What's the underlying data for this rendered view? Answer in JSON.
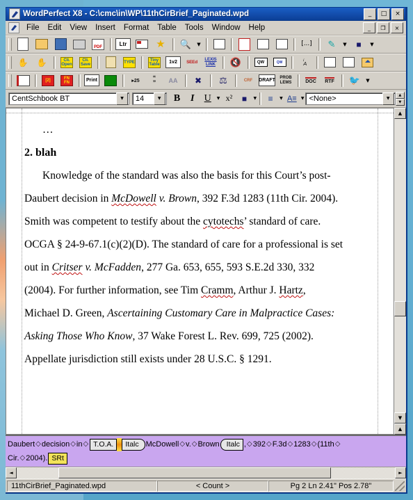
{
  "window": {
    "title": "WordPerfect X8 - C:\\cmc\\in\\WP\\11thCirBrief_Paginated.wpd",
    "app_icon": "wordperfect-pen-icon",
    "controls": {
      "minimize": "_",
      "maximize": "□",
      "close": "×"
    },
    "mdi_controls": {
      "minimize": "_",
      "restore": "❐",
      "close": "×"
    }
  },
  "menubar": {
    "doc_icon": "document-icon",
    "items": [
      {
        "label": "File",
        "mnemonic": "F"
      },
      {
        "label": "Edit",
        "mnemonic": "E"
      },
      {
        "label": "View",
        "mnemonic": "V"
      },
      {
        "label": "Insert",
        "mnemonic": "I"
      },
      {
        "label": "Format",
        "mnemonic": "o"
      },
      {
        "label": "Table",
        "mnemonic": "a"
      },
      {
        "label": "Tools",
        "mnemonic": "T"
      },
      {
        "label": "Window",
        "mnemonic": "W"
      },
      {
        "label": "Help",
        "mnemonic": "H"
      }
    ]
  },
  "toolbar_main": {
    "buttons": [
      {
        "name": "new-document-button",
        "icon": "blank-page-icon",
        "label": ""
      },
      {
        "name": "open-document-button",
        "icon": "open-folder-icon",
        "label": ""
      },
      {
        "name": "save-document-button",
        "icon": "floppy-disk-icon",
        "label": ""
      },
      {
        "name": "print-button",
        "icon": "printer-icon",
        "label": ""
      },
      {
        "name": "publish-pdf-button",
        "icon": "pdf-icon",
        "label": "PDF"
      },
      {
        "name": "letter-macro-button",
        "icon": "ltr-label-icon",
        "label": "Ltr"
      },
      {
        "name": "envelope-button",
        "icon": "envelope-icon",
        "label": "ENV"
      },
      {
        "name": "favorite-button",
        "icon": "star-icon",
        "label": ""
      },
      {
        "name": "zoom-button",
        "icon": "magnifier-icon",
        "label": ""
      },
      {
        "name": "zoom-dropdown",
        "icon": "chevron-down-icon",
        "label": ""
      },
      {
        "name": "show-hide-button",
        "icon": "show-codes-icon",
        "label": ""
      },
      {
        "name": "redline-button",
        "icon": "red-page-icon",
        "label": ""
      },
      {
        "name": "two-page-button",
        "icon": "two-page-icon",
        "label": ""
      },
      {
        "name": "page-setup-button",
        "icon": "page-setup-icon",
        "label": ""
      },
      {
        "name": "insert-field-button",
        "icon": "brackets-icon",
        "label": "[...]"
      },
      {
        "name": "highlight-button",
        "icon": "highlighter-pen-icon",
        "label": ""
      },
      {
        "name": "highlight-dropdown",
        "icon": "chevron-down-icon",
        "label": ""
      },
      {
        "name": "fill-color-button",
        "icon": "paint-bucket-icon",
        "label": ""
      },
      {
        "name": "fill-color-dropdown",
        "icon": "chevron-down-icon",
        "label": ""
      }
    ]
  },
  "toolbar_second": {
    "buttons": [
      {
        "name": "macro-play-button",
        "icon": "macro-icon",
        "label": ""
      },
      {
        "name": "macro-record-button",
        "icon": "macro-record-icon",
        "label": ""
      },
      {
        "name": "client-open-button",
        "icon": "client-open-icon",
        "label": "Cli. Open"
      },
      {
        "name": "client-save-button",
        "icon": "client-save-icon",
        "label": "Cli. Save"
      },
      {
        "name": "clipboard-button",
        "icon": "clipboard-icon",
        "label": ""
      },
      {
        "name": "type-button",
        "icon": "type-icon",
        "label": "TYPE"
      },
      {
        "name": "tiny-table-button",
        "icon": "tiny-table-icon",
        "label": "Tiny Table"
      },
      {
        "name": "line-numbering-button",
        "icon": "line-numbering-icon",
        "label": "1v2"
      },
      {
        "name": "seed-button",
        "icon": "seed-icon",
        "label": "SEEd"
      },
      {
        "name": "lexis-link-button",
        "icon": "lexis-link-icon",
        "label": "LEXIS LINK"
      },
      {
        "name": "mute-button",
        "icon": "no-bell-icon",
        "label": ""
      },
      {
        "name": "quickwords-button",
        "icon": "quickwords-icon",
        "label": "QW"
      },
      {
        "name": "quickwords-edit-button",
        "icon": "quickwords-edit-icon",
        "label": "QW"
      },
      {
        "name": "subscript-button",
        "icon": "subscript-icon",
        "label": "A"
      },
      {
        "name": "indent-button",
        "icon": "indent-icon",
        "label": ""
      },
      {
        "name": "double-indent-button",
        "icon": "double-indent-icon",
        "label": ""
      },
      {
        "name": "open-folder-arrow-button",
        "icon": "folder-up-icon",
        "label": ""
      }
    ]
  },
  "toolbar_third": {
    "buttons": [
      {
        "name": "reading-view-button",
        "icon": "book-icon",
        "label": ""
      },
      {
        "name": "numbering-button",
        "icon": "bracket-number-icon",
        "label": "[2]"
      },
      {
        "name": "footnote-button",
        "icon": "footnote-icon",
        "label": "FN FN"
      },
      {
        "name": "print-excel-button",
        "icon": "excel-print-icon",
        "label": "Print"
      },
      {
        "name": "green-table-button",
        "icon": "green-sheet-icon",
        "label": ""
      },
      {
        "name": "indent-25-button",
        "icon": "indent-25-icon",
        "label": "25"
      },
      {
        "name": "quotation-button",
        "icon": "quote-marks-icon",
        "label": ""
      },
      {
        "name": "small-caps-button",
        "icon": "small-caps-icon",
        "label": "AA"
      },
      {
        "name": "delete-link-button",
        "icon": "broken-link-icon",
        "label": ""
      },
      {
        "name": "scales-button",
        "icon": "scales-of-justice-icon",
        "label": ""
      },
      {
        "name": "crf-button",
        "icon": "crf-arrow-icon",
        "label": "CRF"
      },
      {
        "name": "draft-button",
        "icon": "draft-icon",
        "label": "DRAFT"
      },
      {
        "name": "problems-button",
        "icon": "problems-icon",
        "label": "PROB LEMS"
      },
      {
        "name": "save-as-doc-button",
        "icon": "doc-export-icon",
        "label": "DOC"
      },
      {
        "name": "save-as-rtf-button",
        "icon": "rtf-export-icon",
        "label": "RTF"
      },
      {
        "name": "bird-macro-button",
        "icon": "bird-icon",
        "label": ""
      },
      {
        "name": "bird-macro-dropdown",
        "icon": "chevron-down-icon",
        "label": ""
      }
    ]
  },
  "propertybar": {
    "font_name": "CentSchbook BT",
    "font_size": "14",
    "bold_label": "B",
    "italic_label": "I",
    "underline_label": "U",
    "superscript_label": "x²",
    "highlight_icon": "paint-bucket-a-icon",
    "justification_icon": "justification-icon",
    "style_icon": "text-style-icon",
    "style_value": "<None>"
  },
  "document": {
    "lines": [
      {
        "type": "ellipsis",
        "text": "…"
      },
      {
        "type": "heading",
        "text": "2. blah"
      },
      {
        "type": "body",
        "html": "indent|Knowledge of the standard was also the basis for this Court’s post-"
      },
      {
        "type": "body",
        "text": "Daubert decision in McDowell v. Brown, 392 F.3d 1283 (11th Cir. 2004)."
      },
      {
        "type": "body",
        "text": "Smith was competent to testify about the cytotechs’ standard of care."
      },
      {
        "type": "body",
        "text": "OCGA § 24-9-67.1(c)(2)(D). The standard of care for a professional is set"
      },
      {
        "type": "body",
        "text": "out in Critser v. McFadden, 277 Ga. 653, 655, 593 S.E.2d 330, 332"
      },
      {
        "type": "body",
        "text": "(2004). For further information, see Tim Cramm, Arthur J. Hartz,"
      },
      {
        "type": "body",
        "text": "Michael D. Green, Ascertaining Customary Care in Malpractice Cases:"
      },
      {
        "type": "body",
        "text": "Asking Those Who Know, 37 Wake Forest L. Rev. 699, 725 (2002)."
      },
      {
        "type": "body",
        "text": "Appellate jurisdiction still exists under 28 U.S.C. § 1291."
      }
    ],
    "text_parts": {
      "l1": "…",
      "l2": "2. blah",
      "l3_a": "Knowledge of the standard was also the basis for this Court’s post-",
      "l4_a": "Daubert decision in ",
      "l4_i1": "McDowell",
      "l4_b": " v. Brown",
      "l4_c": ", 392 F.3d 1283 (11th Cir. 2004).",
      "l5_a": "Smith was competent to testify about the ",
      "l5_sp": "cytotechs",
      "l5_b": "’ standard of care.",
      "l6_a": "OCGA § 24-9-67.1(c)(2)(D). The standard of care for a professional is set",
      "l7_a": "out in ",
      "l7_i1": "Critser",
      "l7_i2": " v. McFadden",
      "l7_b": ", 277 Ga. 653, 655, 593 S.E.2d 330, 332",
      "l8_a": "(2004). For further information, see Tim ",
      "l8_sp1": "Cramm",
      "l8_b": ", Arthur J. ",
      "l8_sp2": "Hartz",
      "l8_c": ",",
      "l9_a": "Michael D. Green, ",
      "l9_i": "Ascertaining Customary Care in Malpractice Cases:",
      "l10_i": "Asking Those Who Know",
      "l10_b": ", 37 Wake Forest L. Rev. 699, 725 (2002).",
      "l11_a": "Appellate jurisdiction still exists under 28 U.S.C. § 1291."
    }
  },
  "reveal_codes": {
    "line1": [
      {
        "kind": "word",
        "text": "Daubert"
      },
      {
        "kind": "space"
      },
      {
        "kind": "word",
        "text": "decision"
      },
      {
        "kind": "space"
      },
      {
        "kind": "word",
        "text": "in"
      },
      {
        "kind": "space"
      },
      {
        "kind": "code",
        "text": "T.O.A.",
        "shape": "box"
      },
      {
        "kind": "cursor"
      },
      {
        "kind": "code",
        "text": "Italc",
        "shape": "pointed"
      },
      {
        "kind": "word",
        "text": "McDowell"
      },
      {
        "kind": "space"
      },
      {
        "kind": "word",
        "text": "v."
      },
      {
        "kind": "space"
      },
      {
        "kind": "word",
        "text": "Brown"
      },
      {
        "kind": "code",
        "text": "Italc",
        "shape": "pointed-l"
      },
      {
        "kind": "word",
        "text": ","
      },
      {
        "kind": "space"
      },
      {
        "kind": "word",
        "text": "392"
      },
      {
        "kind": "space"
      },
      {
        "kind": "word",
        "text": "F.3d"
      },
      {
        "kind": "space"
      },
      {
        "kind": "word",
        "text": "1283"
      },
      {
        "kind": "space"
      },
      {
        "kind": "word",
        "text": "(11th"
      },
      {
        "kind": "space"
      }
    ],
    "line2": [
      {
        "kind": "word",
        "text": "Cir."
      },
      {
        "kind": "space"
      },
      {
        "kind": "word",
        "text": "2004)."
      },
      {
        "kind": "code",
        "text": "SRt",
        "shape": "box-hl"
      }
    ],
    "space_glyph": "◇"
  },
  "scrollbars": {
    "up_arrow": "▲",
    "down_arrow": "▼",
    "left_arrow": "◄",
    "right_arrow": "►",
    "prev_page": "▲",
    "next_page": "▼"
  },
  "statusbar": {
    "filename": "11thCirBrief_Paginated.wpd",
    "count": "< Count >",
    "position": "Pg 2 Ln 2.41\" Pos 2.78\""
  }
}
